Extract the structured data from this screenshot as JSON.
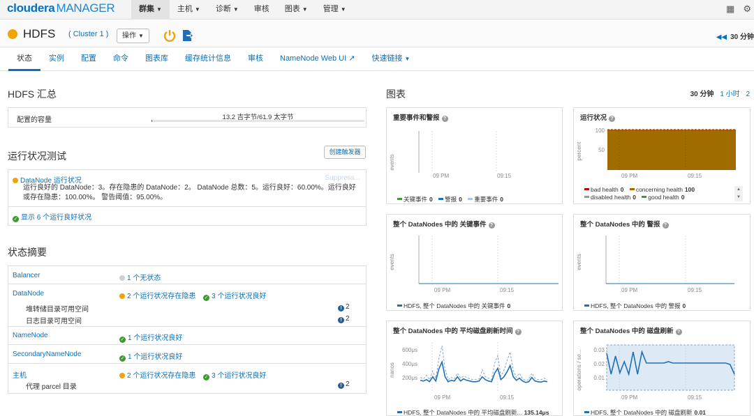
{
  "app": {
    "logo_main": "cloudera",
    "logo_sub": "MANAGER"
  },
  "topnav": [
    {
      "label": "群集",
      "active": true
    },
    {
      "label": "主机"
    },
    {
      "label": "诊断"
    },
    {
      "label": "审核"
    },
    {
      "label": "图表"
    },
    {
      "label": "管理"
    }
  ],
  "service": {
    "name": "HDFS",
    "cluster": "( Cluster 1 )",
    "actions_label": "操作",
    "status_color": "#f0a30a",
    "time_toggle": "30 分钟"
  },
  "tabs": [
    "状态",
    "实例",
    "配置",
    "命令",
    "图表库",
    "缓存统计信息",
    "审核",
    "NameNode Web UI",
    "快速链接"
  ],
  "summary": {
    "title": "HDFS 汇总",
    "capacity_label": "配置的容量",
    "capacity_value": "13.2 吉字节/61.9 太字节",
    "capacity_fraction": 0.0002
  },
  "health_tests": {
    "title": "运行状况测试",
    "create_trigger": "创建触发器",
    "datanode_link": "DataNode 运行状况",
    "suppress": "Suppress...",
    "datanode_text": "运行良好的 DataNode：3。存在隐患的 DataNode：2。 DataNode 总数：5。运行良好：60.00%。运行良好或存在隐患：100.00%。 警告阈值：95.00%。",
    "show_good": "显示 6 个运行良好状况"
  },
  "status_summary": {
    "title": "状态摘要",
    "rows": [
      {
        "name": "Balancer",
        "status": "1 个无状态"
      },
      {
        "name": "DataNode",
        "concern": "2 个运行状况存在隐患",
        "good": "3 个运行状况良好",
        "subs": [
          {
            "label": "堆转储目录可用空间",
            "count": "2"
          },
          {
            "label": "日志目录可用空间",
            "count": "2"
          }
        ]
      },
      {
        "name": "NameNode",
        "good": "1 个运行状况良好"
      },
      {
        "name": "SecondaryNameNode",
        "good": "1 个运行状况良好"
      },
      {
        "name": "主机",
        "concern": "2 个运行状况存在隐患",
        "good": "3 个运行状况良好",
        "subs": [
          {
            "label": "代理 parcel 目录",
            "count": "2"
          }
        ]
      }
    ]
  },
  "charts_panel": {
    "title": "图表",
    "ranges": {
      "current": "30 分钟",
      "options": [
        "1 小时",
        "2"
      ]
    }
  },
  "chart_data": [
    {
      "type": "line",
      "title": "重要事件和警报",
      "ylabel": "events",
      "x_ticks": [
        "09 PM",
        "09:15"
      ],
      "series": [
        {
          "name": "关键事件",
          "value": "0",
          "color": "#3c9a2e"
        },
        {
          "name": "警报",
          "value": "0",
          "color": "#1f6fb5"
        },
        {
          "name": "重要事件",
          "value": "0",
          "color": "#a9c6e3"
        }
      ]
    },
    {
      "type": "area",
      "title": "运行状况",
      "ylabel": "percent",
      "yticks": [
        "100",
        "50"
      ],
      "ylim": [
        0,
        100
      ],
      "x_ticks": [
        "09 PM",
        "09:15"
      ],
      "series": [
        {
          "name": "bad health",
          "value": "0",
          "color": "#c00000"
        },
        {
          "name": "concerning health",
          "value": "100",
          "color": "#a06c00"
        },
        {
          "name": "disabled health",
          "value": "0",
          "color": "#999999"
        },
        {
          "name": "good health",
          "value": "0",
          "color": "#3c9a2e"
        }
      ]
    },
    {
      "type": "line",
      "title": "整个 DataNodes 中的 关键事件",
      "ylabel": "events",
      "x_ticks": [
        "09 PM",
        "09:15"
      ],
      "series": [
        {
          "name": "HDFS, 整个 DataNodes 中的 关键事件",
          "value": "0",
          "color": "#1f6fb5"
        }
      ]
    },
    {
      "type": "line",
      "title": "整个 DataNodes 中的 警报",
      "ylabel": "events",
      "x_ticks": [
        "09 PM",
        "09:15"
      ],
      "series": [
        {
          "name": "HDFS, 整个 DataNodes 中的 警报",
          "value": "0",
          "color": "#1f6fb5"
        }
      ]
    },
    {
      "type": "line",
      "title": "整个 DataNodes 中的 平均磁盘刷新时间",
      "ylabel": "nanos",
      "yticks": [
        "600μs",
        "400μs",
        "200μs"
      ],
      "ylim": [
        0,
        700
      ],
      "x_ticks": [
        "09 PM",
        "09:15"
      ],
      "series": [
        {
          "name": "HDFS, 整个 DataNodes 中的 平均磁盘刷新...",
          "value": "135.14μs",
          "color": "#1f6fb5",
          "values": [
            160,
            150,
            170,
            140,
            210,
            150,
            320,
            420,
            210,
            140,
            160,
            150,
            210,
            150,
            180,
            160,
            150,
            140,
            140,
            150,
            210,
            170,
            150,
            140,
            260,
            330,
            170,
            210,
            280,
            370,
            210,
            160,
            190,
            150,
            130,
            140,
            200,
            150,
            140,
            135,
            150,
            140
          ]
        },
        {
          "name": "max",
          "color": "#7fa7cf",
          "values": [
            200,
            180,
            230,
            170,
            290,
            190,
            460,
            650,
            320,
            170,
            200,
            180,
            260,
            190,
            220,
            200,
            180,
            170,
            170,
            180,
            310,
            210,
            190,
            170,
            400,
            510,
            220,
            300,
            440,
            560,
            300,
            200,
            260,
            180,
            160,
            170,
            260,
            190,
            170,
            170,
            190,
            170
          ]
        }
      ]
    },
    {
      "type": "line",
      "title": "整个 DataNodes 中的 磁盘刷新",
      "ylabel": "operations / se...",
      "yticks": [
        "0.03",
        "0.02",
        "0.01"
      ],
      "ylim": [
        0,
        0.035
      ],
      "x_ticks": [
        "09 PM",
        "09:15"
      ],
      "series": [
        {
          "name": "HDFS, 整个 DataNodes 中的 磁盘刷新",
          "value": "0.01",
          "color": "#1f6fb5",
          "values": [
            0.027,
            0.012,
            0.025,
            0.013,
            0.021,
            0.012,
            0.028,
            0.012,
            0.028,
            0.02,
            0.02,
            0.02,
            0.02,
            0.02,
            0.021,
            0.02,
            0.02,
            0.02,
            0.02,
            0.02,
            0.02,
            0.02,
            0.02,
            0.02,
            0.02,
            0.02,
            0.02,
            0.02,
            0.019,
            0.012
          ]
        }
      ]
    }
  ]
}
